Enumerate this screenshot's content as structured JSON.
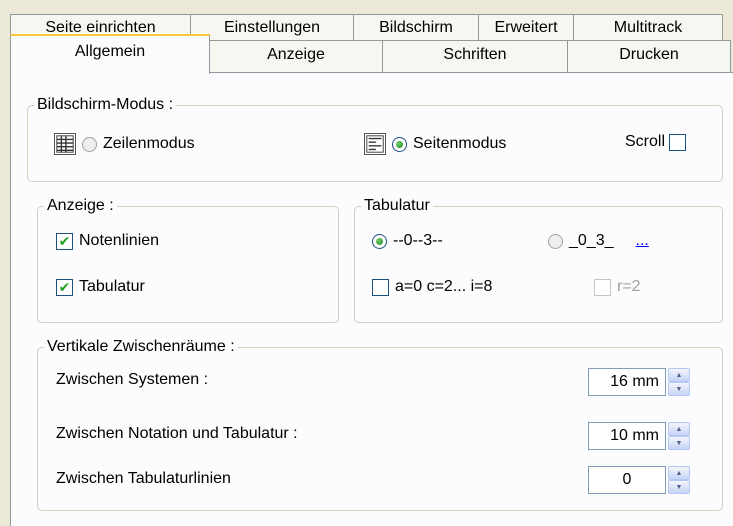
{
  "tabs_back": [
    "Seite einrichten",
    "Einstellungen",
    "Bildschirm",
    "Erweitert",
    "Multitrack"
  ],
  "tabs_front": [
    "Allgemein",
    "Anzeige",
    "Schriften",
    "Drucken"
  ],
  "screen_mode": {
    "legend": "Bildschirm-Modus :",
    "line_mode_label": "Zeilenmodus",
    "line_mode_selected": false,
    "page_mode_label": "Seitenmodus",
    "page_mode_selected": true,
    "scroll_label": "Scroll",
    "scroll_checked": false
  },
  "display": {
    "legend": "Anzeige :",
    "staff_lines_label": "Notenlinien",
    "staff_lines_checked": true,
    "tablature_label": "Tabulatur",
    "tablature_checked": true
  },
  "tablature": {
    "legend": "Tabulatur",
    "style1_label": "--0--3--",
    "style1_selected": true,
    "style2_label": "_0_3_",
    "style2_selected": false,
    "more_link": "...",
    "abc_label": "a=0 c=2... i=8",
    "abc_checked": false,
    "r2_label": "r=2",
    "r2_checked": false
  },
  "spacing": {
    "legend": "Vertikale Zwischenräume :",
    "between_systems_label": "Zwischen Systemen :",
    "between_systems_value": "16 mm",
    "notation_tab_label": "Zwischen Notation und Tabulatur :",
    "notation_tab_value": "10 mm",
    "tab_lines_label": "Zwischen Tabulaturlinien",
    "tab_lines_value": "0"
  }
}
